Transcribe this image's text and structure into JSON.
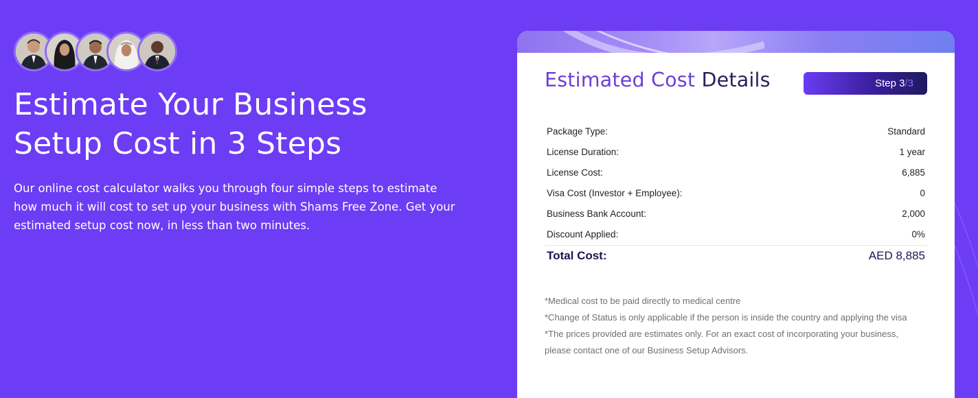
{
  "hero": {
    "title_line1": "Estimate Your Business",
    "title_line2": "Setup Cost in 3 Steps",
    "description": "Our online cost calculator walks you through four simple steps to estimate how much it will cost to set up your business with Shams Free Zone. Get your estimated setup cost now, in less than two minutes."
  },
  "card": {
    "title_accent": "Estimated Cost",
    "title_rest": " Details",
    "step_label": "Step 3",
    "step_total": "/3",
    "rows": [
      {
        "label": "Package Type:",
        "value": "Standard"
      },
      {
        "label": "License Duration:",
        "value": "1 year"
      },
      {
        "label": "License Cost:",
        "value": "6,885"
      },
      {
        "label": "Visa Cost (Investor + Employee):",
        "value": "0"
      },
      {
        "label": "Business Bank Account:",
        "value": "2,000"
      },
      {
        "label": "Discount Applied:",
        "value": "0%"
      }
    ],
    "total_label": "Total Cost:",
    "total_value": "AED 8,885",
    "notes": [
      "*Medical cost to be paid directly to medical centre",
      "*Change of Status is only applicable if the person is inside the country and applying the visa",
      "*The prices provided are estimates only. For an exact cost of incorporating your business, please contact one of our Business Setup Advisors."
    ]
  },
  "colors": {
    "background": "#6d3cf5",
    "accent": "#6a3fd6",
    "heading_dark": "#2a1f5e"
  }
}
